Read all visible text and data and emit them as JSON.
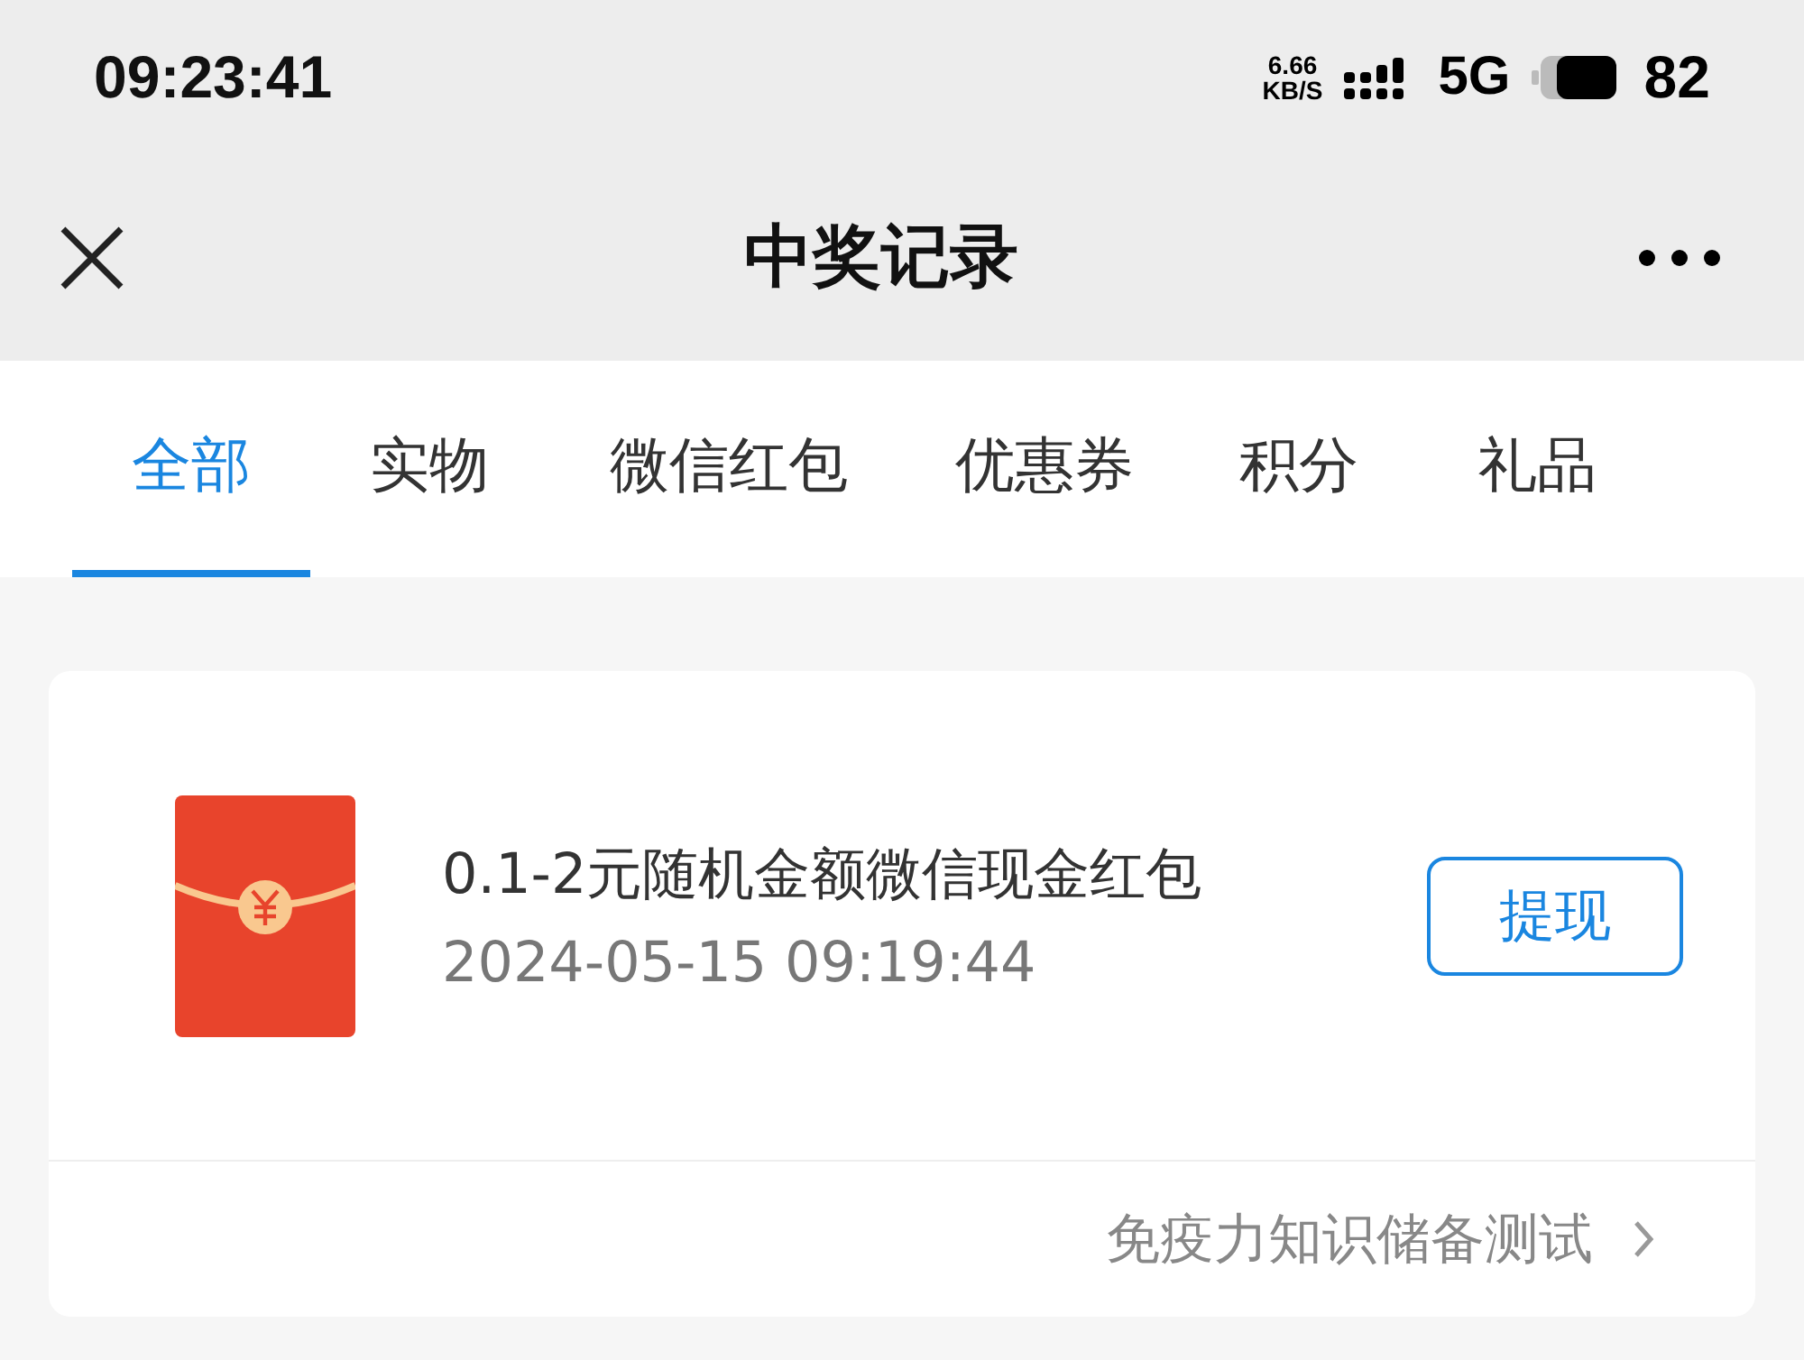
{
  "status_bar": {
    "time": "09:23:41",
    "net_speed_value": "6.66",
    "net_speed_unit": "KB/S",
    "network": "5G",
    "battery": "82"
  },
  "nav": {
    "title": "中奖记录"
  },
  "tabs": [
    {
      "label": "全部",
      "selected": true
    },
    {
      "label": "实物",
      "selected": false
    },
    {
      "label": "微信红包",
      "selected": false
    },
    {
      "label": "优惠券",
      "selected": false
    },
    {
      "label": "积分",
      "selected": false
    },
    {
      "label": "礼品",
      "selected": false
    }
  ],
  "records": [
    {
      "title": "0.1-2元随机金额微信现金红包",
      "time": "2024-05-15 09:19:44",
      "action": "提现",
      "source": "免疫力知识储备测试"
    }
  ]
}
